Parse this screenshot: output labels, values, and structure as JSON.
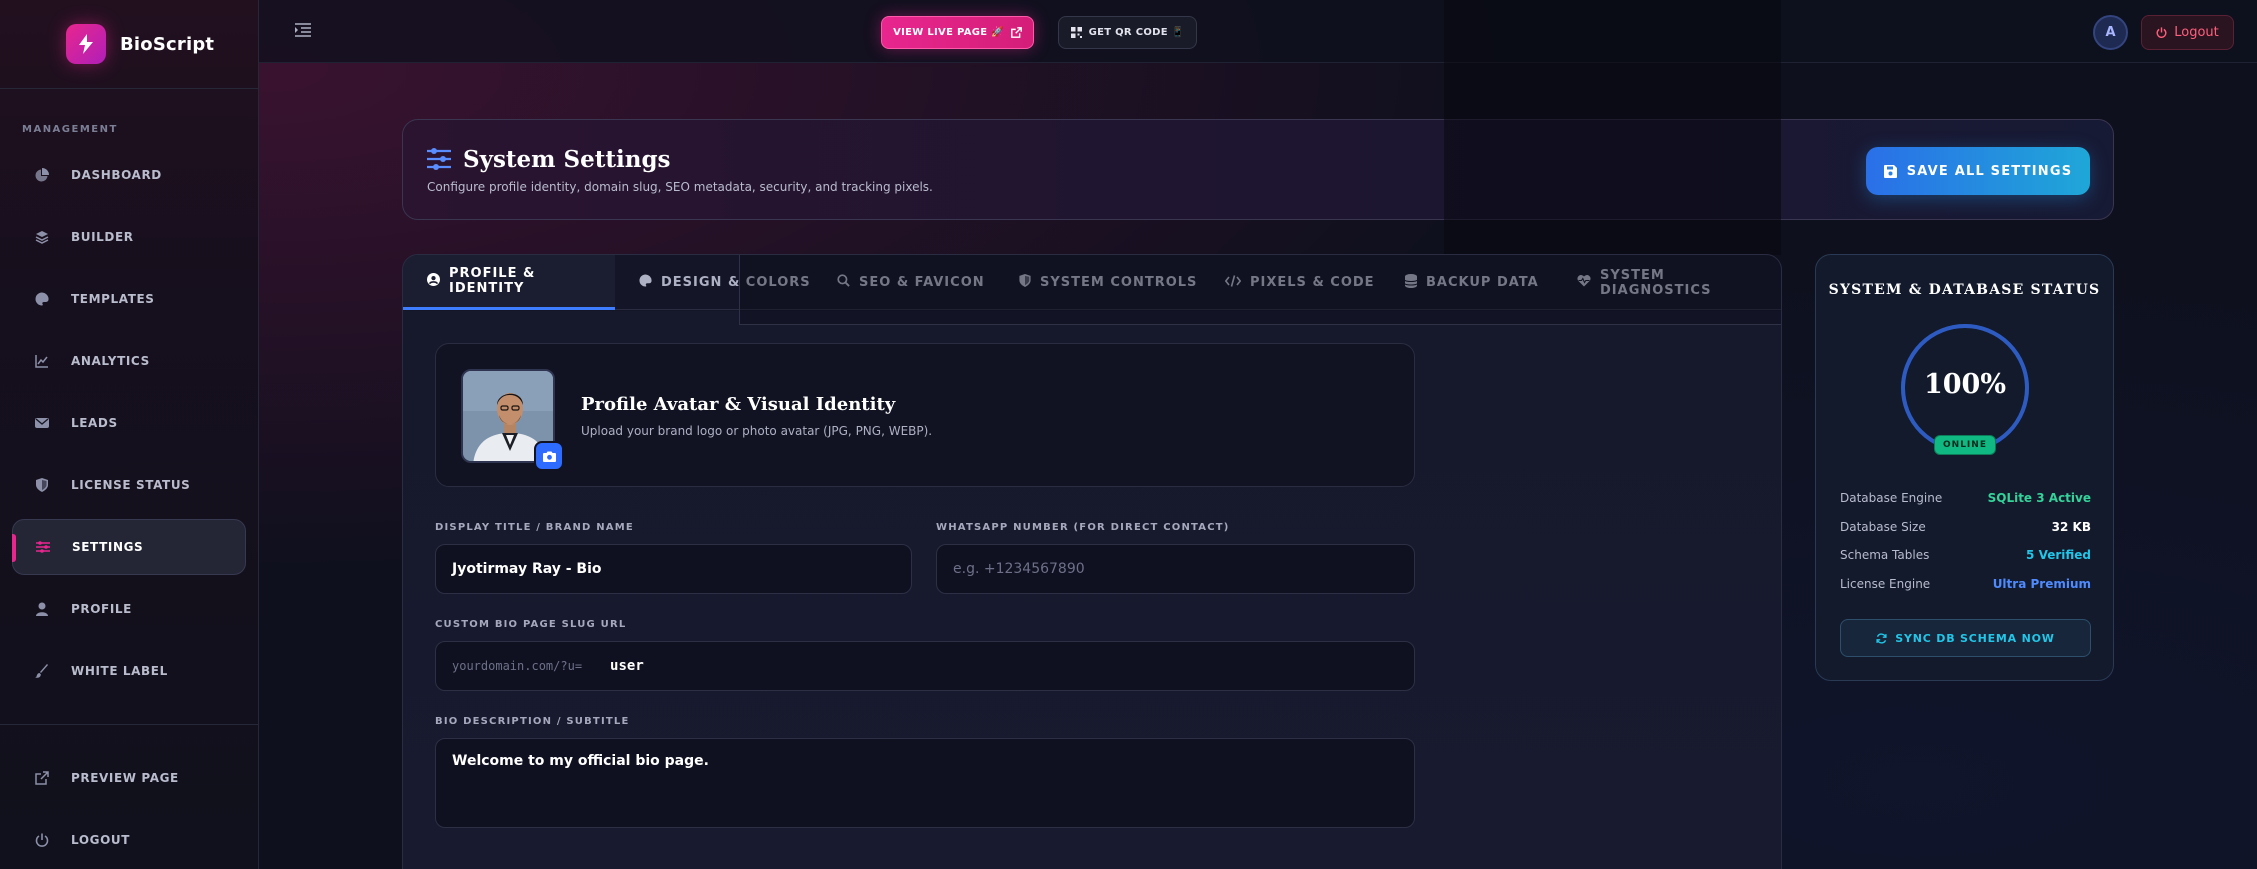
{
  "brand": {
    "name": "BioScript"
  },
  "sidebar": {
    "section_label": "MANAGEMENT",
    "items": [
      {
        "label": "DASHBOARD",
        "icon": "pie-chart-icon"
      },
      {
        "label": "BUILDER",
        "icon": "layers-icon"
      },
      {
        "label": "TEMPLATES",
        "icon": "palette-icon"
      },
      {
        "label": "ANALYTICS",
        "icon": "line-chart-icon"
      },
      {
        "label": "LEADS",
        "icon": "envelope-icon"
      },
      {
        "label": "LICENSE STATUS",
        "icon": "shield-icon"
      },
      {
        "label": "SETTINGS",
        "icon": "sliders-icon"
      },
      {
        "label": "PROFILE",
        "icon": "user-icon"
      },
      {
        "label": "WHITE LABEL",
        "icon": "brush-icon"
      }
    ],
    "bottom_items": [
      {
        "label": "PREVIEW PAGE",
        "icon": "external-link-icon"
      },
      {
        "label": "LOGOUT",
        "icon": "power-icon"
      }
    ]
  },
  "topbar": {
    "view_live_label": "VIEW LIVE PAGE 🚀",
    "qr_label": "GET QR CODE 📱",
    "avatar_initial": "A",
    "logout_label": "Logout"
  },
  "header": {
    "title": "System Settings",
    "subtitle": "Configure profile identity, domain slug, SEO metadata, security, and tracking pixels.",
    "save_label": "SAVE ALL SETTINGS"
  },
  "tabs": [
    {
      "label": "PROFILE & IDENTITY",
      "icon": "user-circle-icon"
    },
    {
      "label": "DESIGN & COLORS",
      "icon": "palette-icon"
    },
    {
      "label": "SEO & FAVICON",
      "icon": "search-icon"
    },
    {
      "label": "SYSTEM CONTROLS",
      "icon": "shield-icon"
    },
    {
      "label": "PIXELS & CODE",
      "icon": "code-icon"
    },
    {
      "label": "BACKUP DATA",
      "icon": "database-icon"
    },
    {
      "label": "SYSTEM DIAGNOSTICS",
      "icon": "heart-pulse-icon"
    }
  ],
  "profile": {
    "avatar_title": "Profile Avatar & Visual Identity",
    "avatar_subtitle": "Upload your brand logo or photo avatar (JPG, PNG, WEBP).",
    "display_title_label": "DISPLAY TITLE / BRAND NAME",
    "display_title_value": "Jyotirmay Ray - Bio",
    "whatsapp_label": "WHATSAPP NUMBER (FOR DIRECT CONTACT)",
    "whatsapp_placeholder": "e.g. +1234567890",
    "slug_label": "CUSTOM BIO PAGE SLUG URL",
    "slug_prefix": "yourdomain.com/?u=",
    "slug_value": "user",
    "bio_label": "BIO DESCRIPTION / SUBTITLE",
    "bio_value": "Welcome to my official bio page."
  },
  "status": {
    "title": "SYSTEM & DATABASE STATUS",
    "health_value": "100%",
    "health_percent": 100,
    "online_label": "ONLINE",
    "rows": [
      {
        "key": "Database Engine",
        "value": "SQLite 3 Active",
        "color": "#34d399"
      },
      {
        "key": "Database Size",
        "value": "32 KB",
        "color": "#ffffff"
      },
      {
        "key": "Schema Tables",
        "value": "5 Verified",
        "color": "#22c6e8"
      },
      {
        "key": "License Engine",
        "value": "Ultra Premium",
        "color": "#4f8bff"
      }
    ],
    "sync_label": "SYNC DB SCHEMA NOW"
  },
  "colors": {
    "accent": "#e8268e",
    "primary": "#2e6bff",
    "success": "#10b981"
  }
}
